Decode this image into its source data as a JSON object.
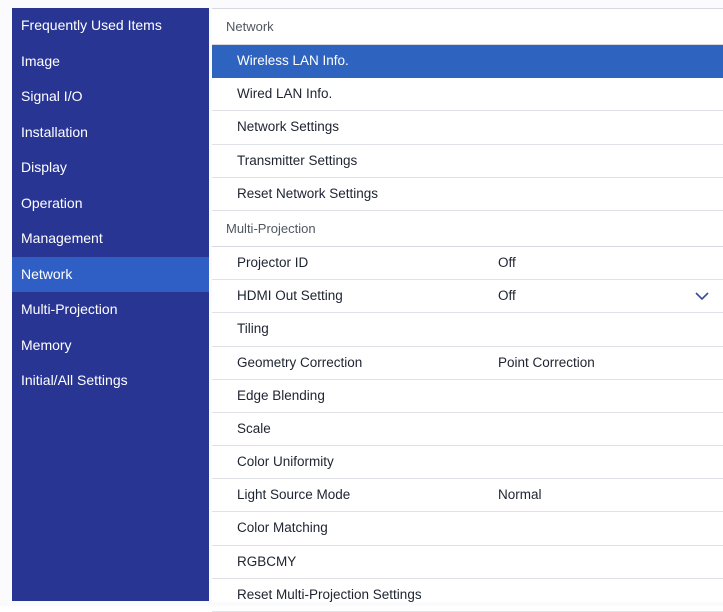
{
  "sidebar": {
    "items": [
      {
        "label": "Frequently Used Items"
      },
      {
        "label": "Image"
      },
      {
        "label": "Signal I/O"
      },
      {
        "label": "Installation"
      },
      {
        "label": "Display"
      },
      {
        "label": "Operation"
      },
      {
        "label": "Management"
      },
      {
        "label": "Network"
      },
      {
        "label": "Multi-Projection"
      },
      {
        "label": "Memory"
      },
      {
        "label": "Initial/All Settings"
      }
    ],
    "active": "Network"
  },
  "network": {
    "title": "Network",
    "items": [
      {
        "label": "Wireless LAN Info."
      },
      {
        "label": "Wired LAN Info."
      },
      {
        "label": "Network Settings"
      },
      {
        "label": "Transmitter Settings"
      },
      {
        "label": "Reset Network Settings"
      }
    ]
  },
  "multiprojection": {
    "title": "Multi-Projection",
    "items": [
      {
        "label": "Projector ID",
        "value": "Off"
      },
      {
        "label": "HDMI Out Setting",
        "value": "Off"
      },
      {
        "label": "Tiling"
      },
      {
        "label": "Geometry Correction",
        "value": "Point Correction"
      },
      {
        "label": "Edge Blending"
      },
      {
        "label": "Scale"
      },
      {
        "label": "Color Uniformity"
      },
      {
        "label": "Light Source Mode",
        "value": "Normal"
      },
      {
        "label": "Color Matching"
      },
      {
        "label": "RGBCMY"
      },
      {
        "label": "Reset Multi-Projection Settings"
      }
    ]
  },
  "colors": {
    "sidebar_bg": "#283593",
    "active_bg": "#2f5ec4",
    "selected_row_bg": "#2f63c0"
  }
}
